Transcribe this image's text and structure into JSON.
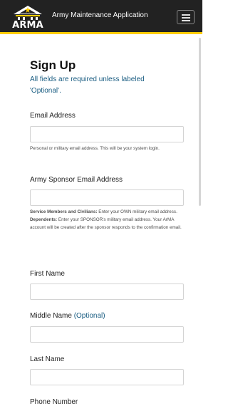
{
  "header": {
    "logo_text": "ARMA",
    "app_title": "Army Maintenance Application",
    "menu_icon": "hamburger-menu-icon"
  },
  "form": {
    "heading": "Sign Up",
    "subtitle": "All fields are required unless labeled 'Optional'.",
    "email": {
      "label": "Email Address",
      "value": "",
      "help": "Personal or military email address. This will be your system login."
    },
    "sponsor_email": {
      "label": "Army Sponsor Email Address",
      "value": "",
      "help_1_bold": "Service Members and Civilians:",
      "help_1_text": " Enter your OWN military email address.",
      "help_2_bold": "Dependents:",
      "help_2_text": " Enter your SPONSOR's military email address. Your ArMA account will be created after the sponsor responds to the confirmation email."
    },
    "first_name": {
      "label": "First Name",
      "value": ""
    },
    "middle_name": {
      "label": "Middle Name",
      "optional_tag": "(Optional)",
      "value": ""
    },
    "last_name": {
      "label": "Last Name",
      "value": ""
    },
    "phone": {
      "label": "Phone Number"
    }
  },
  "colors": {
    "navbar_bg": "#222222",
    "navbar_accent": "#ffcc01",
    "link_blue": "#1a5d82"
  }
}
